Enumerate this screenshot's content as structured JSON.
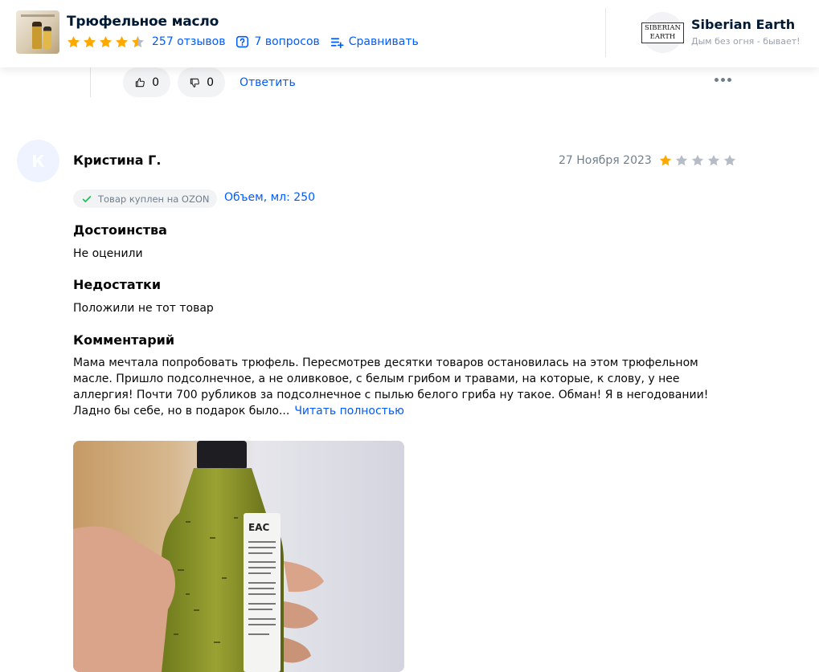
{
  "header": {
    "product_title": "Трюфельное масло",
    "rating_stars": 4.5,
    "reviews_link": "257 отзывов",
    "questions_link": "7 вопросов",
    "compare_link": "Сравнивать",
    "brand_logo_text": "SIBERIAN EARTH",
    "brand_name": "Siberian Earth",
    "brand_slogan": "Дым без огня - бывает!"
  },
  "prev_review_footer": {
    "likes": "0",
    "dislikes": "0",
    "reply_label": "Ответить"
  },
  "review": {
    "avatar_letter": "К",
    "author": "Кристина Г.",
    "date": "27 Ноября 2023",
    "rating": 1,
    "rating_max": 5,
    "purchase_badge": "Товар куплен на OZON",
    "variant": "Объем, мл: 250",
    "pros_title": "Достоинства",
    "pros_text": "Не оценили",
    "cons_title": "Недостатки",
    "cons_text": "Положили не тот товар",
    "comment_title": "Комментарий",
    "comment_text": "Мама мечтала попробовать трюфель. Пересмотрев десятки товаров остановилась на этом трюфельном масле. Пришло подсолнечное, а не оливковое, с белым грибом и травами, на которые, к слову, у нее аллергия! Почти 700 рубликов за подсолнечное с пылью белого гриба ну такое. Обман! Я в негодовании! Ладно бы себе, но в подарок было...",
    "read_more": "Читать полностью",
    "photo_label": "EAC"
  },
  "colors": {
    "accent": "#005bff",
    "star_filled": "#ffa800",
    "star_empty": "#b5bcc5",
    "secondary_text": "#707f8d",
    "pill_bg": "#f2f3f5"
  }
}
